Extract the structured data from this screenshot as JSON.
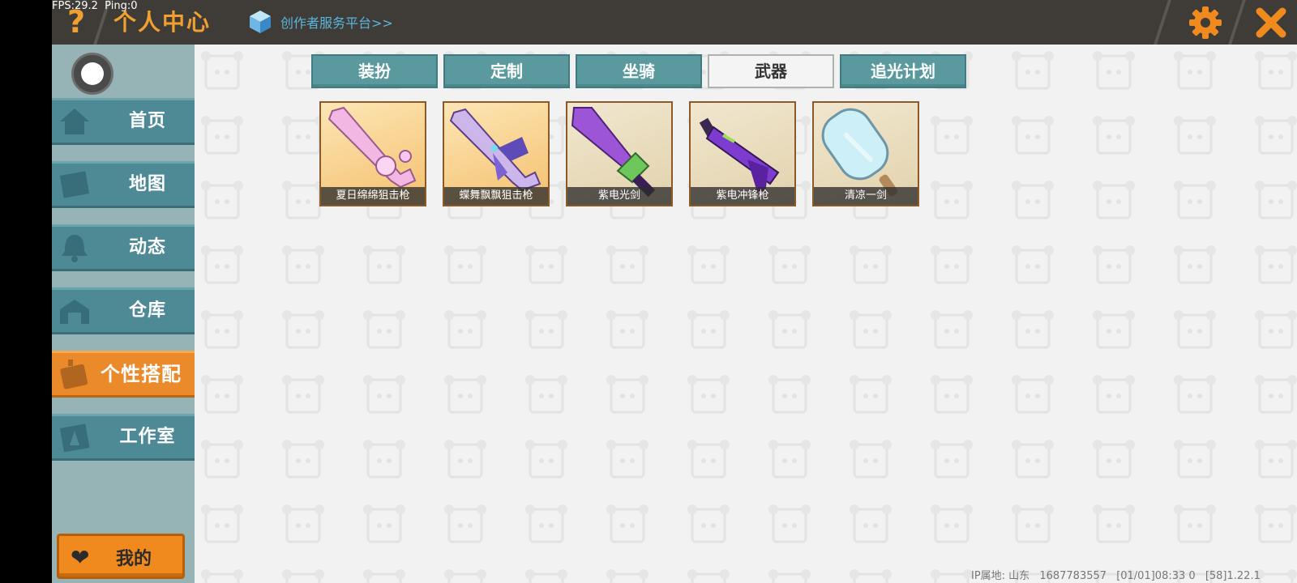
{
  "status": {
    "fps": "FPS:29.2",
    "ping": "Ping:0"
  },
  "header": {
    "help_icon": "question-icon",
    "title": "个人中心",
    "creator_link": "创作者服务平台>>",
    "colors": {
      "accent": "#f0a030",
      "bar": "#3f3c37"
    }
  },
  "sidebar": {
    "items": [
      {
        "label": "首页",
        "icon": "home-icon"
      },
      {
        "label": "地图",
        "icon": "map-icon"
      },
      {
        "label": "动态",
        "icon": "bell-icon"
      },
      {
        "label": "仓库",
        "icon": "warehouse-icon"
      },
      {
        "label": "个性搭配",
        "icon": "outfit-icon",
        "active": true
      },
      {
        "label": "工作室",
        "icon": "studio-icon"
      }
    ],
    "my_button": "我的"
  },
  "tabs": [
    {
      "label": "装扮"
    },
    {
      "label": "定制"
    },
    {
      "label": "坐骑"
    },
    {
      "label": "武器",
      "active": true
    },
    {
      "label": "追光计划"
    }
  ],
  "weapons": [
    {
      "name": "夏日绵绵狙击枪"
    },
    {
      "name": "蝶舞飘飘狙击枪"
    },
    {
      "name": "紫电光剑"
    },
    {
      "name": "紫电冲锋枪"
    },
    {
      "name": "清凉一剑"
    }
  ],
  "footer": {
    "ip": "IP属地: 山东",
    "uid": "1687783557",
    "time": "[01/01]08:33 0",
    "version": "[58]1.22.1"
  }
}
